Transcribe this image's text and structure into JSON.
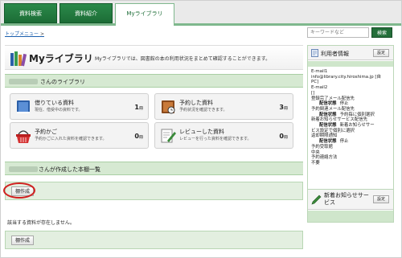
{
  "tabs": [
    "資料検索",
    "資料紹介",
    "Myライブラリ"
  ],
  "breadcrumb": {
    "label": "トップメニュー",
    "sep": ">"
  },
  "search": {
    "placeholder": "キーワードなど",
    "button": "検索"
  },
  "page": {
    "title": "Myライブラリ",
    "description": "Myライブラリでは、図書館の本の利用状況をまとめて確認することができます。"
  },
  "library_section": {
    "title": "さんのライブラリ"
  },
  "cards": [
    {
      "title": "借りている資料",
      "sub": "現在、借受中の資料です。",
      "count": "1",
      "unit": "冊"
    },
    {
      "title": "予約した資料",
      "sub": "予約状況を確認できます。",
      "count": "3",
      "unit": "冊"
    },
    {
      "title": "予約かご",
      "sub": "予約かごに入れた資料を確認できます。",
      "count": "0",
      "unit": "冊"
    },
    {
      "title": "レビューした資料",
      "sub": "レビューを行った資料を確認できます。",
      "count": "0",
      "unit": "冊"
    }
  ],
  "shelf_section": {
    "title": "さんが作成した本棚一覧",
    "create_button": "棚作成",
    "empty_message": "該当する資料が存在しません。"
  },
  "user_info": {
    "title": "利用者情報",
    "settings_button": "設定",
    "lines": [
      {
        "text": "E-mail1"
      },
      {
        "text": "info@library.city.hiroshima.jp [自"
      },
      {
        "text": "PC]"
      },
      {
        "text": "E-mail2"
      },
      {
        "text": "[]"
      },
      {
        "text": "登録完了メール配信先"
      },
      {
        "label": "配信状態",
        "text": "停止"
      },
      {
        "text": "予約関連メール配信先"
      },
      {
        "label": "配信状態",
        "text": "予約毎に個別選択"
      },
      {
        "text": "新着お知らせサービス配信先"
      },
      {
        "label": "配信状態",
        "text": "新着お知らせサー"
      },
      {
        "text": "ビス設定で個別に選択"
      },
      {
        "text": "返却期限通知"
      },
      {
        "label": "配信状態",
        "text": "停止"
      },
      {
        "text": "予約受取館"
      },
      {
        "text": "中央"
      },
      {
        "text": "予約連絡方法"
      },
      {
        "text": "不要"
      }
    ]
  },
  "news": {
    "title": "新着お知らせサービス",
    "settings_button": "設定"
  },
  "colors": {
    "tab_green": "#1c6c36",
    "section_green": "#d6e9d2",
    "highlight_red": "#d12020"
  }
}
